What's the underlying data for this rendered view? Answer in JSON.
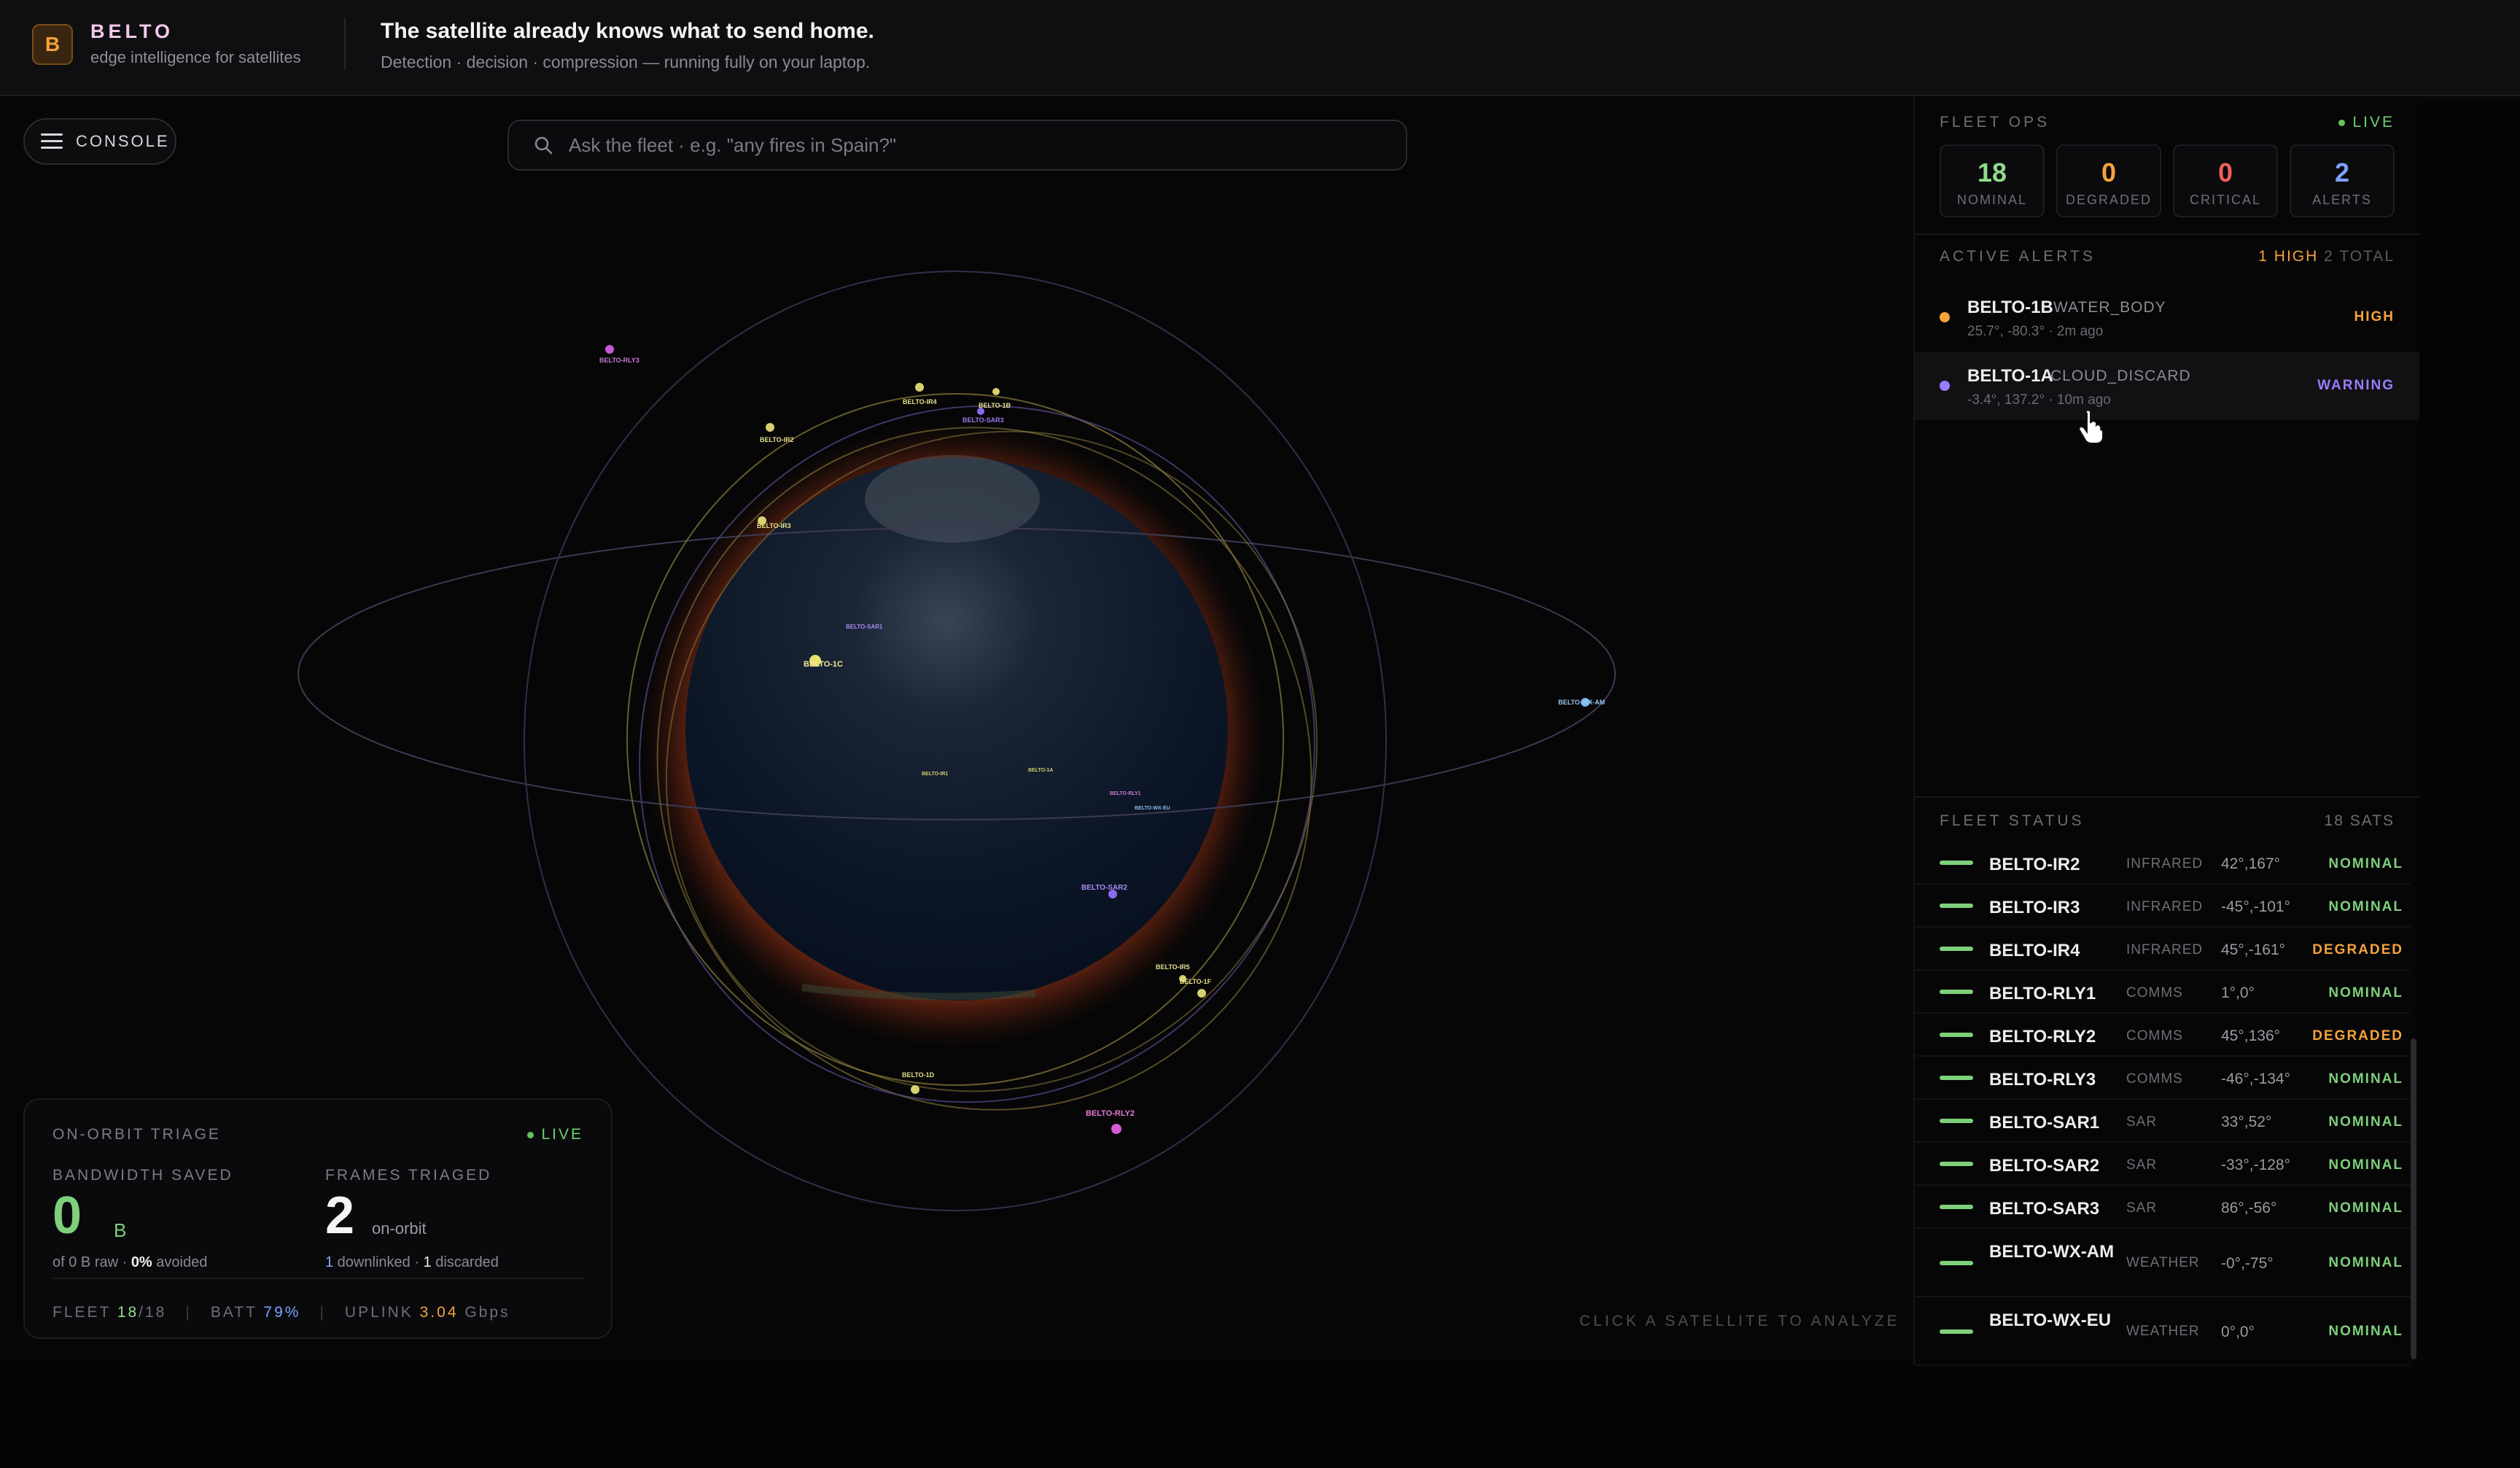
{
  "header": {
    "logo_letter": "B",
    "brand": "BELTO",
    "tagline": "edge intelligence for satellites",
    "headline": "The satellite already knows what to send home.",
    "subline": "Detection · decision · compression — running fully on your laptop."
  },
  "console": {
    "label": "CONSOLE",
    "icon": "hamburger-icon"
  },
  "search": {
    "placeholder": "Ask the fleet · e.g. \"any fires in Spain?\"",
    "value": "",
    "icon": "search-icon"
  },
  "map": {
    "hint": "CLICK A SATELLITE TO ANALYZE",
    "satellite_labels": {
      "rly3_top": "BELTO-RLY3",
      "ir4": "BELTO-IR4",
      "ir2": "BELTO-IR2",
      "s1b": "BELTO-1B",
      "sar3": "BELTO-SAR3",
      "ir3": "BELTO-IR3",
      "s1c": "BELTO-1C",
      "sar1": "BELTO-SAR1",
      "ir1": "BELTO-IR1",
      "s1a": "BELTO-1A",
      "rly1": "BELTO-RLY1",
      "wxeu": "BELTO-WX-EU",
      "wxam": "BELTO-WX-AM",
      "sar2": "BELTO-SAR2",
      "ir5": "BELTO-IR5",
      "s1f": "BELTO-1F",
      "s1d": "BELTO-1D",
      "rly2": "BELTO-RLY2"
    },
    "colors": {
      "earth_glow": "#c2451c",
      "orbit_gold": "#8a7a3a",
      "orbit_violet": "#5a4a8a"
    }
  },
  "triage": {
    "title": "ON-ORBIT TRIAGE",
    "live": "LIVE",
    "bandwidth_label": "BANDWIDTH SAVED",
    "bandwidth_value": "0",
    "bandwidth_unit": "B",
    "bandwidth_sub_pre": "of 0 B raw · ",
    "bandwidth_pct": "0%",
    "bandwidth_sub_post": " avoided",
    "frames_label": "FRAMES TRIAGED",
    "frames_value": "2",
    "frames_unit": "on-orbit",
    "downlinked": "1",
    "downlinked_label": " downlinked · ",
    "discarded": "1",
    "discarded_label": " discarded",
    "fleet_label": "FLEET",
    "fleet_value": "18",
    "fleet_total": "/18",
    "batt_label": "BATT",
    "batt_value": "79%",
    "uplink_label": "UPLINK",
    "uplink_value": "3.04",
    "uplink_unit": "Gbps"
  },
  "ops": {
    "title": "FLEET OPS",
    "live": "LIVE",
    "stats": [
      {
        "value": "18",
        "label": "NOMINAL",
        "color": "#8fdc8a"
      },
      {
        "value": "0",
        "label": "DEGRADED",
        "color": "#f5a33b"
      },
      {
        "value": "0",
        "label": "CRITICAL",
        "color": "#f0605a"
      },
      {
        "value": "2",
        "label": "ALERTS",
        "color": "#7aa2ff"
      }
    ]
  },
  "alerts": {
    "title": "ACTIVE ALERTS",
    "high_count": "1 HIGH",
    "total": "2 TOTAL",
    "items": [
      {
        "sat": "BELTO-1B",
        "kind": "WATER_BODY",
        "meta": "25.7°, -80.3° · 2m ago",
        "severity": "HIGH",
        "color": "#f5a33b"
      },
      {
        "sat": "BELTO-1A",
        "kind": "CLOUD_DISCARD",
        "meta": "-3.4°, 137.2° · 10m ago",
        "severity": "WARNING",
        "color": "#9b7bff"
      }
    ]
  },
  "fleet": {
    "title": "FLEET STATUS",
    "count": "18 SATS",
    "rows": [
      {
        "name": "BELTO-IR2",
        "type": "INFRARED",
        "coord": "42°,167°",
        "status": "NOMINAL"
      },
      {
        "name": "BELTO-IR3",
        "type": "INFRARED",
        "coord": "-45°,-101°",
        "status": "NOMINAL"
      },
      {
        "name": "BELTO-IR4",
        "type": "INFRARED",
        "coord": "45°,-161°",
        "status": "DEGRADED"
      },
      {
        "name": "BELTO-RLY1",
        "type": "COMMS",
        "coord": "1°,0°",
        "status": "NOMINAL"
      },
      {
        "name": "BELTO-RLY2",
        "type": "COMMS",
        "coord": "45°,136°",
        "status": "DEGRADED"
      },
      {
        "name": "BELTO-RLY3",
        "type": "COMMS",
        "coord": "-46°,-134°",
        "status": "NOMINAL"
      },
      {
        "name": "BELTO-SAR1",
        "type": "SAR",
        "coord": "33°,52°",
        "status": "NOMINAL"
      },
      {
        "name": "BELTO-SAR2",
        "type": "SAR",
        "coord": "-33°,-128°",
        "status": "NOMINAL"
      },
      {
        "name": "BELTO-SAR3",
        "type": "SAR",
        "coord": "86°,-56°",
        "status": "NOMINAL"
      },
      {
        "name": "BELTO-WX-AM",
        "type": "WEATHER",
        "coord": "-0°,-75°",
        "status": "NOMINAL"
      },
      {
        "name": "BELTO-WX-EU",
        "type": "WEATHER",
        "coord": "0°,0°",
        "status": "NOMINAL"
      }
    ]
  }
}
